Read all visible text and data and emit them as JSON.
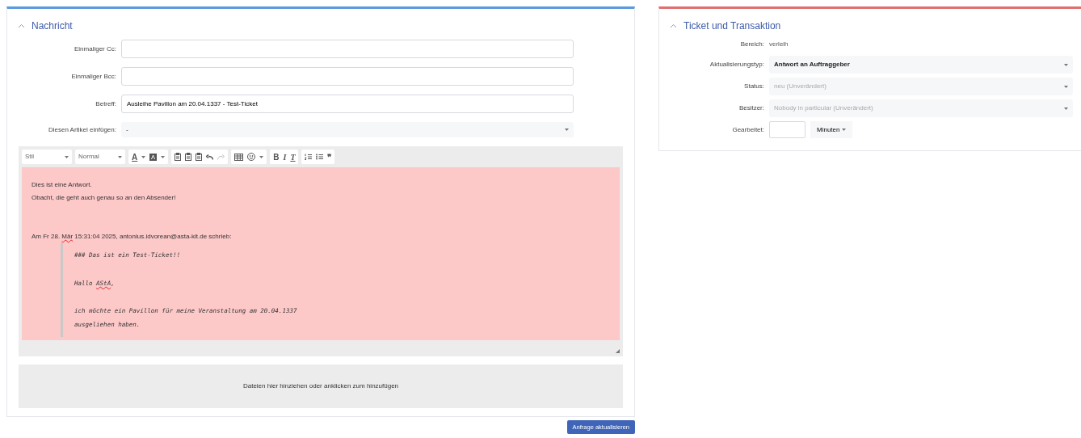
{
  "message_panel": {
    "title": "Nachricht",
    "expanded": true,
    "fields": [
      {
        "label": "Einmaliger Cc:",
        "kind": "input"
      },
      {
        "label": "Einmaliger Bcc:",
        "kind": "input"
      },
      {
        "label": "Betreff:",
        "kind": "input",
        "value": "Ausleihe Pavillon am 20.04.1337 - Test-Ticket"
      },
      {
        "label": "Diesen Artikel einfügen:",
        "kind": "select",
        "value": "-"
      }
    ],
    "toolbar": {
      "selects": [
        "Stil",
        "Normal"
      ],
      "font_color": "A",
      "remove_format": "T",
      "bold": "B",
      "italic": "I",
      "quote": "❞"
    },
    "body": [
      {
        "kind": "text",
        "segments": [
          {
            "text": "Dies ist eine Antwort.",
            "misspelled": false
          }
        ]
      },
      {
        "kind": "text",
        "segments": [
          {
            "text": "Obacht, die geht auch genau so an den Absender!",
            "misspelled": false
          }
        ]
      },
      {
        "kind": "blank"
      },
      {
        "kind": "blank"
      },
      {
        "kind": "text",
        "segments": [
          {
            "text": "Am Fr 28. ",
            "misspelled": false
          },
          {
            "text": "Mär",
            "misspelled": true
          },
          {
            "text": " 15:31:04 2025, antonius.idvorean@asta-kit.de schrieb:",
            "misspelled": false
          }
        ]
      },
      {
        "kind": "quote",
        "lines": [
          {
            "kind": "text",
            "segments": [
              {
                "text": "### Das ist ein Test-Ticket!!",
                "misspelled": false
              }
            ]
          },
          {
            "kind": "blank"
          },
          {
            "kind": "text",
            "segments": [
              {
                "text": "Hallo ",
                "misspelled": false
              },
              {
                "text": "AStA",
                "misspelled": true
              },
              {
                "text": ",",
                "misspelled": false
              }
            ]
          },
          {
            "kind": "blank"
          },
          {
            "kind": "text",
            "segments": [
              {
                "text": "ich möchte ein Pavillon für meine Veranstaltung am 20.04.1337",
                "misspelled": false
              }
            ]
          },
          {
            "kind": "text",
            "segments": [
              {
                "text": "ausgeliehen haben.",
                "misspelled": false
              }
            ]
          }
        ]
      }
    ],
    "dropzone": "Dateien hier hinziehen oder anklicken zum hinzufügen"
  },
  "submit_button": "Anfrage aktualisieren",
  "ticket_panel": {
    "title": "Ticket und Transaktion",
    "expanded": true,
    "fields": [
      {
        "label": "Bereich:",
        "kind": "static",
        "value": "verleih"
      },
      {
        "label": "Aktualisierungstyp:",
        "kind": "select",
        "value": "Antwort an Auftraggeber",
        "disabled": false
      },
      {
        "label": "Status:",
        "kind": "select",
        "value": "neu (Unverändert)",
        "disabled": true
      },
      {
        "label": "Besitzer:",
        "kind": "select",
        "value": "Nobody in particular (Unverändert)",
        "disabled": true
      },
      {
        "label": "Gearbeitet:",
        "kind": "duration",
        "unit": "Minuten"
      }
    ]
  }
}
